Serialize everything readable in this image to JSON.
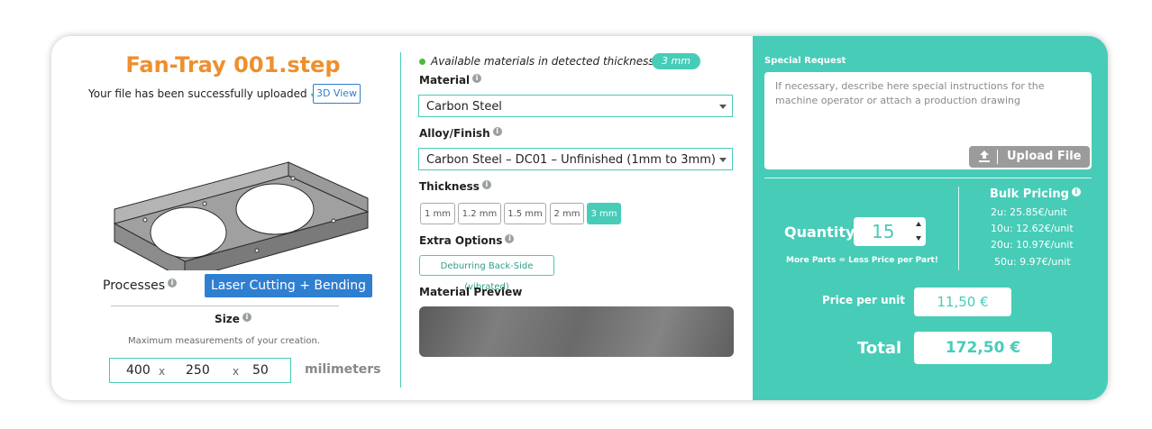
{
  "file": {
    "title": "Fan-Tray 001.step",
    "upload_status": "Your file has been successfully uploaded",
    "view_button": "3D View"
  },
  "processes": {
    "label": "Processes",
    "value": "Laser Cutting + Bending"
  },
  "size": {
    "label": "Size",
    "subtitle": "Maximum measurements of your creation.",
    "x": "400",
    "y": "250",
    "z": "50",
    "separator": "x",
    "unit": "milimeters"
  },
  "materials": {
    "available_text": "Available materials in detected thickness of",
    "detected_thickness": "3 mm",
    "material_label": "Material",
    "material_value": "Carbon Steel",
    "alloy_label": "Alloy/Finish",
    "alloy_value": "Carbon Steel – DC01 – Unfinished (1mm to 3mm)",
    "thickness_label": "Thickness",
    "thickness_options": [
      "1 mm",
      "1.2 mm",
      "1.5 mm",
      "2 mm",
      "3 mm"
    ],
    "thickness_selected": "3 mm",
    "extra_label": "Extra Options",
    "extra_option": "Deburring Back-Side (vibrated)",
    "preview_label": "Material Preview"
  },
  "special_request": {
    "label": "Special Request",
    "placeholder": "If necessary, describe here special instructions for the machine operator or attach a production drawing",
    "upload_button": "Upload File"
  },
  "order": {
    "quantity_label": "Quantity",
    "quantity_value": "15",
    "more_parts_note": "More Parts = Less Price per Part!",
    "bulk_title": "Bulk Pricing",
    "bulk_tiers": [
      "2u: 25.85€/unit",
      "10u: 12.62€/unit",
      "20u: 10.97€/unit",
      "50u: 9.97€/unit"
    ],
    "price_label": "Price per unit",
    "price_value": "11,50 €",
    "total_label": "Total",
    "total_value": "172,50 €"
  },
  "colors": {
    "accent": "#47ccb8",
    "title": "#ee8f2e",
    "button_blue": "#2f7fd1",
    "available_dot": "#4fb840"
  },
  "icons": [
    "checkmark-icon",
    "info-icon",
    "dropdown-caret-icon",
    "upload-icon",
    "spinner-up-icon",
    "spinner-down-icon"
  ]
}
